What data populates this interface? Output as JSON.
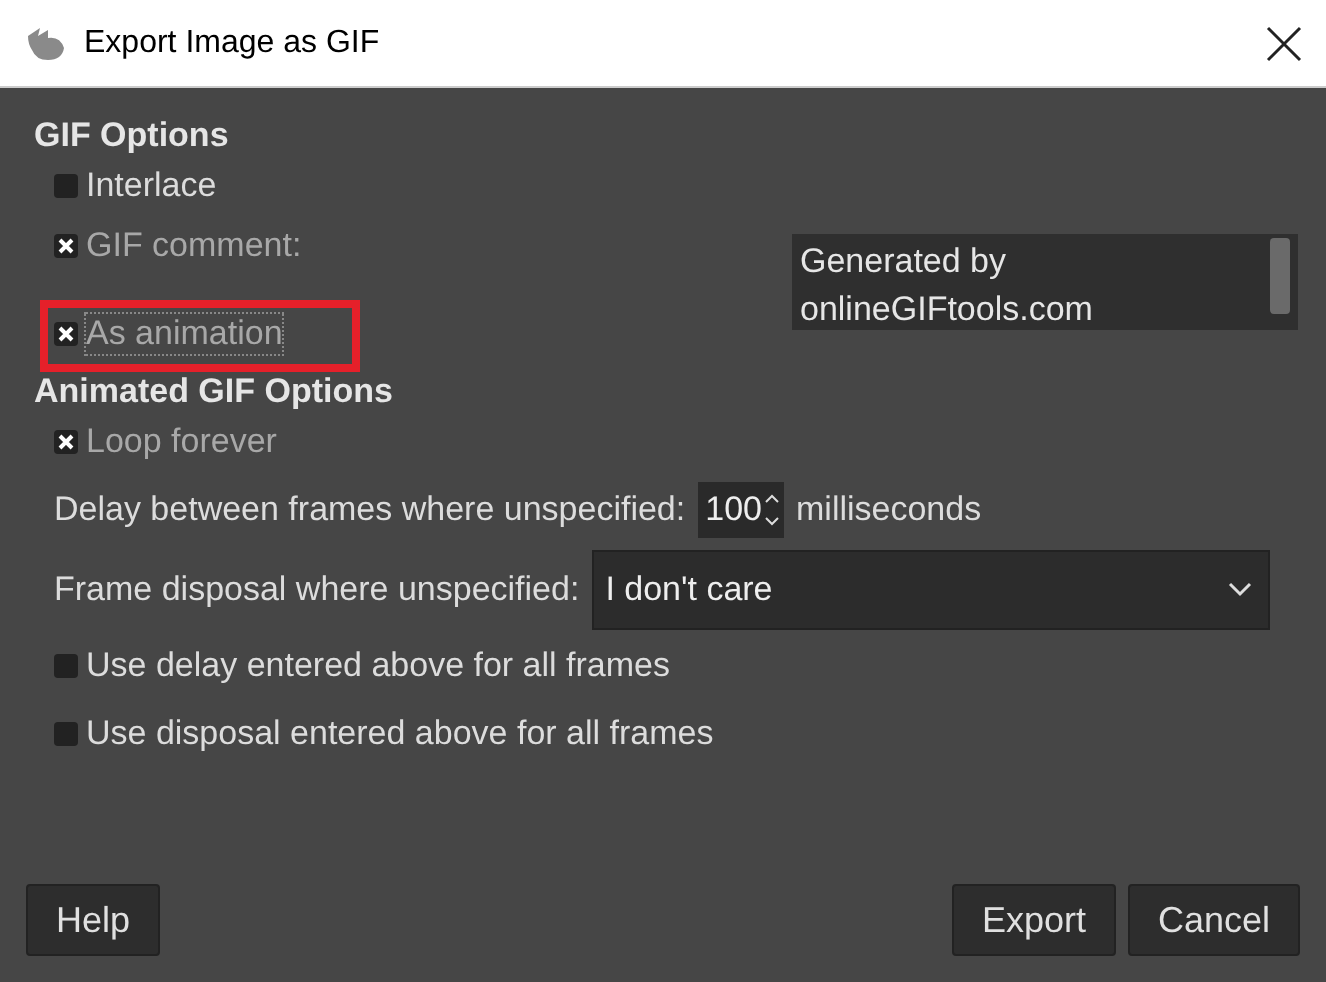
{
  "window": {
    "title": "Export Image as GIF"
  },
  "gif_options": {
    "heading": "GIF Options",
    "interlace": {
      "label": "Interlace",
      "checked": false,
      "disabled": false
    },
    "comment": {
      "label": "GIF comment:",
      "checked": true,
      "disabled": true,
      "value": "Generated by onlineGIFtools.com"
    },
    "as_animation": {
      "label": "As animation",
      "checked": true,
      "disabled": true,
      "highlighted": true
    }
  },
  "animated_options": {
    "heading": "Animated GIF Options",
    "loop_forever": {
      "label": "Loop forever",
      "checked": true,
      "disabled": true
    },
    "delay": {
      "label": "Delay between frames where unspecified:",
      "value": "100",
      "unit": "milliseconds"
    },
    "disposal": {
      "label": "Frame disposal where unspecified:",
      "value": "I don't care"
    },
    "use_delay": {
      "label": "Use delay entered above for all frames",
      "checked": false,
      "disabled": false
    },
    "use_disposal": {
      "label": "Use disposal entered above for all frames",
      "checked": false,
      "disabled": false
    }
  },
  "buttons": {
    "help": "Help",
    "export": "Export",
    "cancel": "Cancel"
  }
}
